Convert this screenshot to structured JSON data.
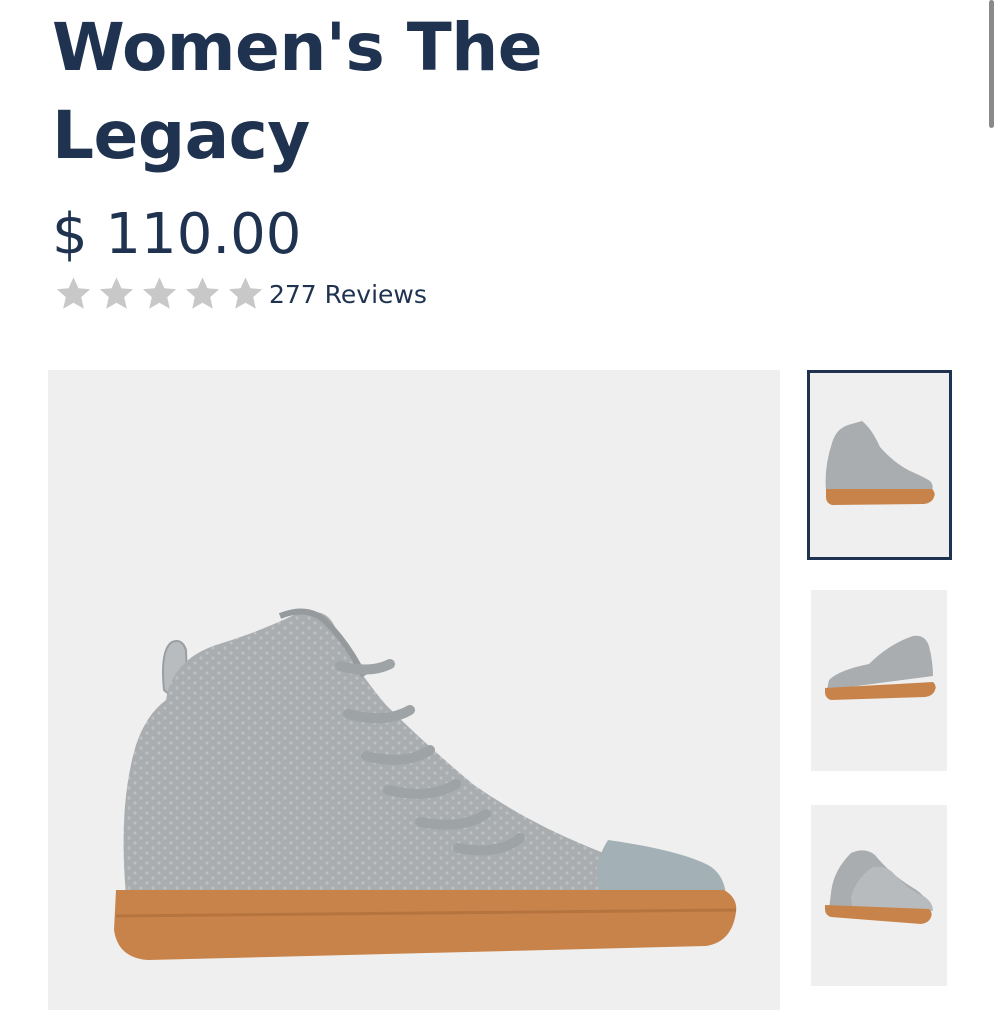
{
  "product": {
    "title": "Women's The Legacy",
    "price": "$ 110.00",
    "rating": {
      "stars_total": 5,
      "stars_filled": 0,
      "reviews_label": "277 Reviews"
    }
  },
  "gallery": {
    "selected_index": 0,
    "thumbnail_count": 3
  },
  "colors": {
    "heading": "#1f3350",
    "star": "#c8c8c8",
    "image_bg": "#efefef",
    "shoe_knit": "#a9adaf",
    "sole": "#c8834a"
  }
}
